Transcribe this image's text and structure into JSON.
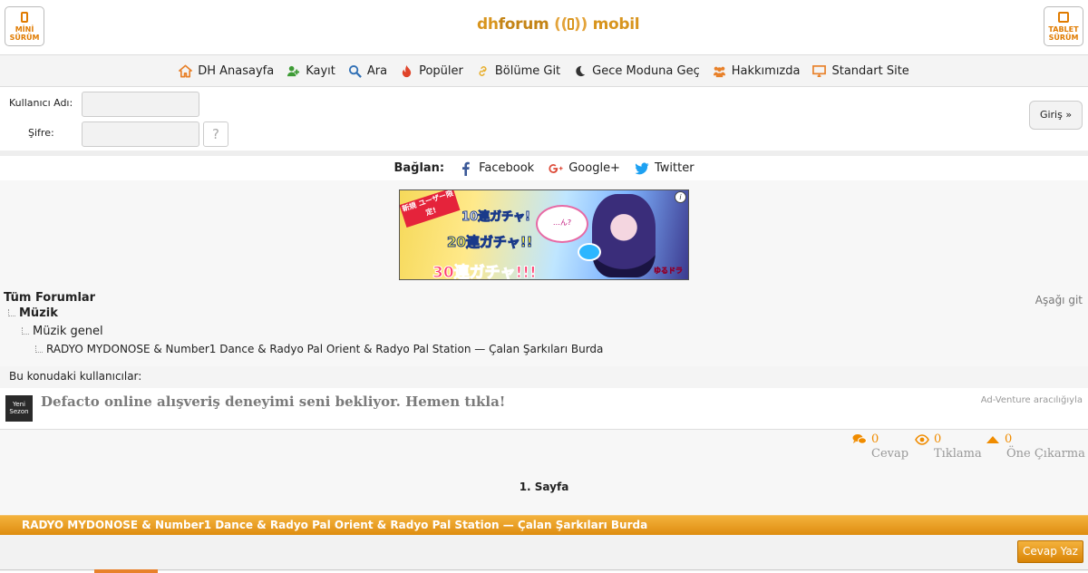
{
  "header": {
    "mini_label_1": "MİNİ",
    "mini_label_2": "SÜRÜM",
    "tablet_label_1": "TABLET",
    "tablet_label_2": "SÜRÜM",
    "logo_dh": "dh",
    "logo_forum": "forum",
    "logo_mobil": "mobil"
  },
  "nav": {
    "items": [
      {
        "label": "DH Anasayfa",
        "icon": "home-icon"
      },
      {
        "label": "Kayıt",
        "icon": "user-plus-icon"
      },
      {
        "label": "Ara",
        "icon": "search-icon"
      },
      {
        "label": "Popüler",
        "icon": "fire-icon"
      },
      {
        "label": "Bölüme Git",
        "icon": "link-icon"
      },
      {
        "label": "Gece Moduna Geç",
        "icon": "moon-icon"
      },
      {
        "label": "Hakkımızda",
        "icon": "users-icon"
      },
      {
        "label": "Standart Site",
        "icon": "desktop-icon"
      }
    ]
  },
  "login": {
    "username_label": "Kullanıcı Adı:",
    "username_value": "",
    "password_label": "Şifre:",
    "password_value": "",
    "help_label": "?",
    "submit_label": "Giriş »"
  },
  "social": {
    "connect_label": "Bağlan:",
    "facebook": "Facebook",
    "google": "Google+",
    "twitter": "Twitter"
  },
  "banner_ad": {
    "badge": "新規 ユーザー限定!",
    "line1": "10連ガチャ!",
    "line2": "20連ガチャ!!",
    "line3": "30連ガチャ!!!",
    "bubble": "…ん?",
    "brand": "ゆるドラ",
    "info": "i"
  },
  "breadcrumb": {
    "root": "Tüm Forumlar",
    "level1": "Müzik",
    "level2": "Müzik genel",
    "level3": "RADYO MYDONOSE & Number1 Dance & Radyo Pal Orient & Radyo Pal Station — Çalan Şarkıları Burda",
    "jump_down": "Aşağı git"
  },
  "users_label": "Bu konudaki kullanıcılar:",
  "sponsored": {
    "thumb_text_1": "Yeni",
    "thumb_text_2": "Sezon",
    "text": "Defacto online alışveriş deneyimi seni bekliyor. Hemen tıkla!",
    "via": "Ad-Venture aracılığıyla"
  },
  "stats": {
    "replies": {
      "count": "0",
      "label": "Cevap"
    },
    "clicks": {
      "count": "0",
      "label": "Tıklama"
    },
    "boosts": {
      "count": "0",
      "label": "Öne Çıkarma"
    }
  },
  "page_label": "1. Sayfa",
  "topic_title": "RADYO MYDONOSE & Number1 Dance & Radyo Pal Orient & Radyo Pal Station — Çalan Şarkıları Burda",
  "reply_button": "Cevap Yaz",
  "colors": {
    "accent": "#e8922a",
    "brand": "#d8951e",
    "link": "#222222"
  }
}
